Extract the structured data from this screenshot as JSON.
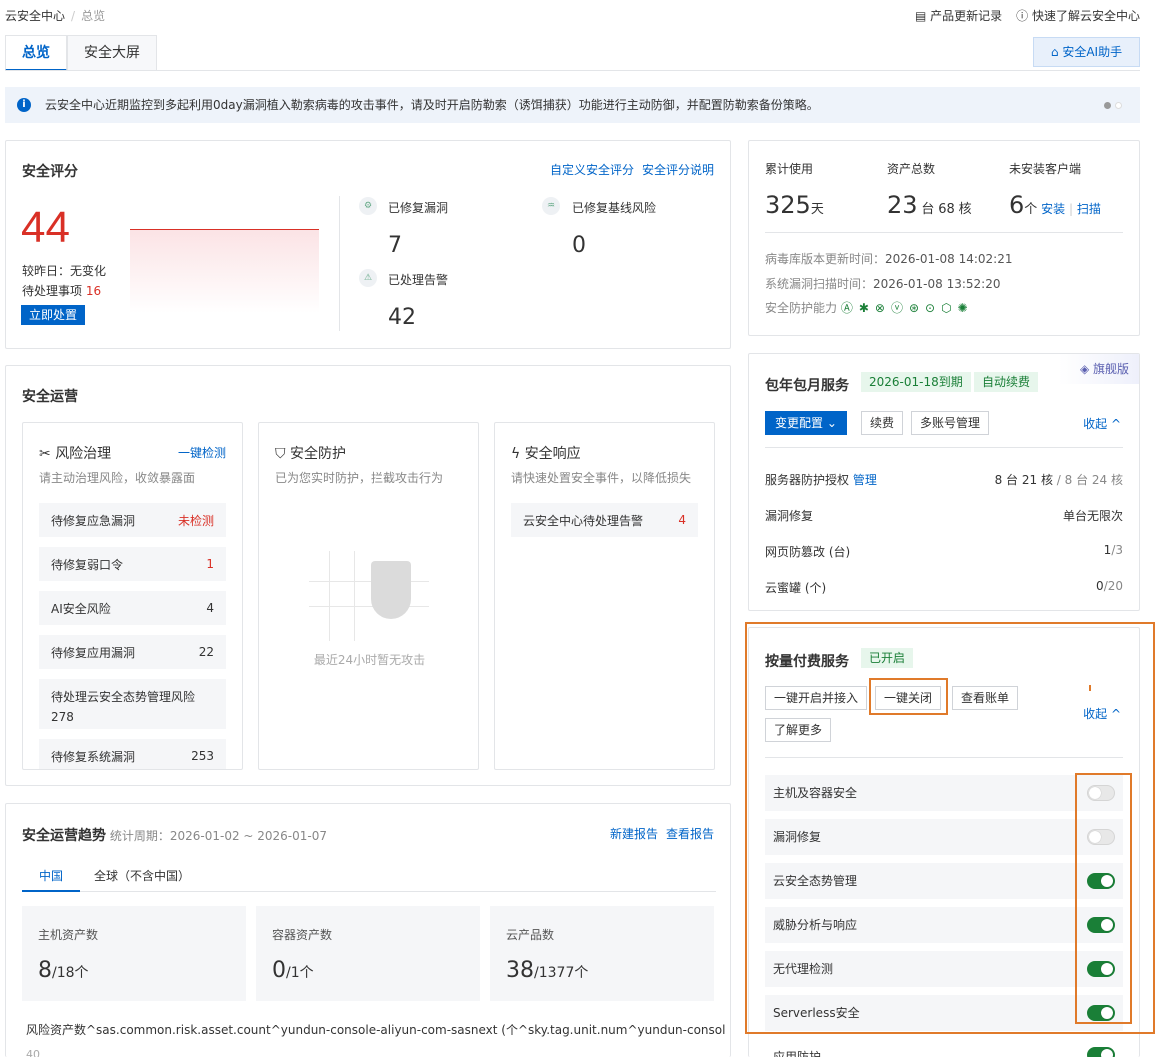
{
  "breadcrumb": {
    "root": "云安全中心",
    "current": "总览"
  },
  "toplinks": {
    "changelog": "产品更新记录",
    "learn": "快速了解云安全中心"
  },
  "tabs": [
    "总览",
    "安全大屏"
  ],
  "ai_button": "安全AI助手",
  "notice": "云安全中心近期监控到多起利用0day漏洞植入勒索病毒的攻击事件，请及时开启防勒索（诱饵捕获）功能进行主动防御，并配置防勒索备份策略。",
  "score_card": {
    "title": "安全评分",
    "link_custom": "自定义安全评分",
    "link_explain": "安全评分说明",
    "score": "44",
    "vs_yesterday": "较昨日：无变化",
    "pending_label": "待处理事项",
    "pending_value": "16",
    "action": "立即处置",
    "stats": [
      {
        "label": "已修复漏洞",
        "value": "7"
      },
      {
        "label": "已修复基线风险",
        "value": "0"
      },
      {
        "label": "已处理告警",
        "value": "42"
      }
    ]
  },
  "summary_card": {
    "used_label": "累计使用",
    "used_value": "325",
    "used_unit": "天",
    "assets_label": "资产总数",
    "assets_value": "23",
    "assets_unit1": "台",
    "assets_value2": "68",
    "assets_unit2": "核",
    "uninstalled_label": "未安装客户端",
    "uninstalled_value": "6",
    "uninstalled_unit": "个",
    "install": "安装",
    "scan": "扫描",
    "virus_db_label": "病毒库版本更新时间：",
    "virus_db_time": "2026-01-08 14:02:21",
    "vuln_scan_label": "系统漏洞扫描时间：",
    "vuln_scan_time": "2026-01-08 13:52:20",
    "protection_label": "安全防护能力"
  },
  "ops": {
    "title": "安全运营",
    "risk": {
      "title": "风险治理",
      "link": "一键检测",
      "desc": "请主动治理风险，收敛暴露面",
      "rows": [
        {
          "label": "待修复应急漏洞",
          "value": "未检测"
        },
        {
          "label": "待修复弱口令",
          "value": "1"
        },
        {
          "label": "AI安全风险",
          "value": "4"
        },
        {
          "label": "待修复应用漏洞",
          "value": "22"
        },
        {
          "label": "待处理云安全态势管理风险",
          "value": "278"
        },
        {
          "label": "待修复系统漏洞",
          "value": "253"
        }
      ]
    },
    "protect": {
      "title": "安全防护",
      "desc": "已为您实时防护，拦截攻击行为",
      "empty": "最近24小时暂无攻击"
    },
    "response": {
      "title": "安全响应",
      "desc": "请快速处置安全事件，以降低损失",
      "row_label": "云安全中心待处理告警",
      "row_value": "4"
    }
  },
  "trend": {
    "title": "安全运营趋势",
    "period_label": "统计周期：",
    "period": "2026-01-02 ~ 2026-01-07",
    "link_new": "新建报告",
    "link_view": "查看报告",
    "tabs": [
      "中国",
      "全球（不含中国）"
    ],
    "kpis": [
      {
        "label": "主机资产数",
        "value": "8",
        "total": "/18个"
      },
      {
        "label": "容器资产数",
        "value": "0",
        "total": "/1个"
      },
      {
        "label": "云产品数",
        "value": "38",
        "total": "/1377个"
      }
    ],
    "footer": "风险资产数^sas.common.risk.asset.count^yundun-console-aliyun-com-sasnext (个^sky.tag.unit.num^yundun-console-a",
    "axis_tick": "40"
  },
  "subscription": {
    "badge": "旗舰版",
    "title": "包年包月服务",
    "expiry": "2026-01-18到期",
    "renew_tag": "自动续费",
    "btn_change": "变更配置",
    "btn_renew": "续费",
    "btn_multi": "多账号管理",
    "collapse": "收起",
    "rows": [
      {
        "label": "服务器防护授权",
        "link": "管理",
        "v1": "8 台 21 核",
        "v2": "/ 8 台 24 核"
      },
      {
        "label": "漏洞修复",
        "link": "",
        "v1": "单台无限次",
        "v2": ""
      },
      {
        "label": "网页防篡改 (台)",
        "link": "",
        "v1": "1",
        "v2": "/3"
      },
      {
        "label": "云蜜罐 (个)",
        "link": "",
        "v1": "0",
        "v2": "/20"
      }
    ]
  },
  "payg": {
    "title": "按量付费服务",
    "status": "已开启",
    "btn_enable": "一键开启并接入",
    "btn_close": "一键关闭",
    "btn_bill": "查看账单",
    "btn_more": "了解更多",
    "collapse": "收起",
    "services": [
      {
        "label": "主机及容器安全",
        "on": false
      },
      {
        "label": "漏洞修复",
        "on": false
      },
      {
        "label": "云安全态势管理",
        "on": true
      },
      {
        "label": "威胁分析与响应",
        "on": true
      },
      {
        "label": "无代理检测",
        "on": true
      },
      {
        "label": "Serverless安全",
        "on": true
      },
      {
        "label": "应用防护",
        "on": true
      }
    ]
  },
  "colors": {
    "primary": "#0064c8",
    "danger": "#d93026",
    "success": "#1a7f37",
    "highlight": "#e07a2a"
  }
}
